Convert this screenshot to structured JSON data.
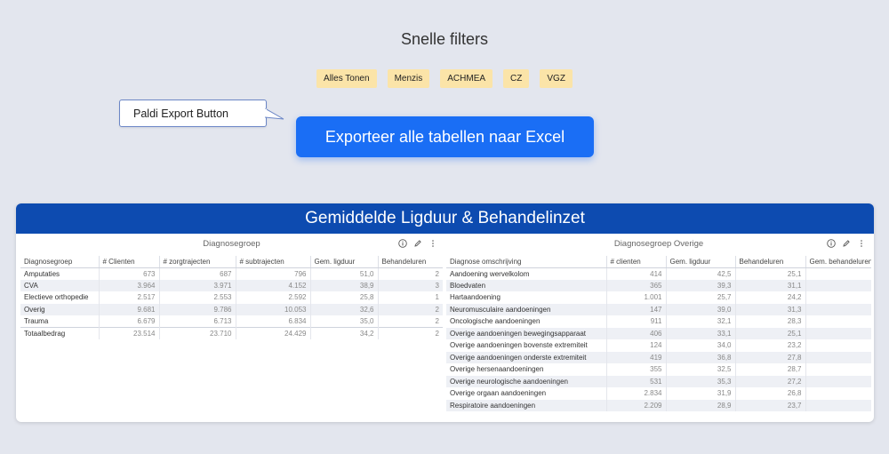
{
  "filters": {
    "title": "Snelle filters",
    "chips": [
      "Alles Tonen",
      "Menzis",
      "ACHMEA",
      "CZ",
      "VGZ"
    ]
  },
  "callout": {
    "label": "Paldi Export Button"
  },
  "export_button": {
    "label": "Exporteer alle tabellen naar Excel"
  },
  "panel": {
    "title": "Gemiddelde Ligduur & Behandelinzet",
    "widget1": {
      "title": "Diagnosegroep",
      "columns": [
        "Diagnosegroep",
        "# Clienten",
        "# zorgtrajecten",
        "# subtrajecten",
        "Gem. ligduur",
        "Behandeluren"
      ],
      "rows": [
        [
          "Amputaties",
          "673",
          "687",
          "796",
          "51,0",
          "2"
        ],
        [
          "CVA",
          "3.964",
          "3.971",
          "4.152",
          "38,9",
          "3"
        ],
        [
          "Electieve orthopedie",
          "2.517",
          "2.553",
          "2.592",
          "25,8",
          "1"
        ],
        [
          "Overig",
          "9.681",
          "9.786",
          "10.053",
          "32,6",
          "2"
        ],
        [
          "Trauma",
          "6.679",
          "6.713",
          "6.834",
          "35,0",
          "2"
        ]
      ],
      "total": [
        "Totaalbedrag",
        "23.514",
        "23.710",
        "24.429",
        "34,2",
        "2"
      ]
    },
    "widget2": {
      "title": "Diagnosegroep Overige",
      "columns": [
        "Diagnose omschrijving",
        "# clienten",
        "Gem. ligduur",
        "Behandeluren",
        "Gem. behandeluren"
      ],
      "rows": [
        [
          "Aandoening wervelkolom",
          "414",
          "42,5",
          "25,1",
          ""
        ],
        [
          "Bloedvaten",
          "365",
          "39,3",
          "31,1",
          ""
        ],
        [
          "Hartaandoening",
          "1.001",
          "25,7",
          "24,2",
          ""
        ],
        [
          "Neuromusculaire aandoeningen",
          "147",
          "39,0",
          "31,3",
          ""
        ],
        [
          "Oncologische aandoeningen",
          "911",
          "32,1",
          "28,3",
          ""
        ],
        [
          "Overige aandoeningen bewegingsapparaat",
          "406",
          "33,1",
          "25,1",
          ""
        ],
        [
          "Overige aandoeningen bovenste extremiteit",
          "124",
          "34,0",
          "23,2",
          ""
        ],
        [
          "Overige aandoeningen onderste extremiteit",
          "419",
          "36,8",
          "27,8",
          ""
        ],
        [
          "Overige hersenaandoeningen",
          "355",
          "32,5",
          "28,7",
          ""
        ],
        [
          "Overige neurologische aandoeningen",
          "531",
          "35,3",
          "27,2",
          ""
        ],
        [
          "Overige orgaan aandoeningen",
          "2.834",
          "31,9",
          "26,8",
          ""
        ],
        [
          "Respiratoire aandoeningen",
          "2.209",
          "28,9",
          "23,7",
          ""
        ]
      ]
    }
  },
  "colors": {
    "primary": "#1a6ef5",
    "header": "#0d4bb0",
    "chip": "#fbe4a8",
    "background": "#e3e6ee"
  },
  "icons": [
    "info-icon",
    "edit-icon",
    "more-icon"
  ]
}
